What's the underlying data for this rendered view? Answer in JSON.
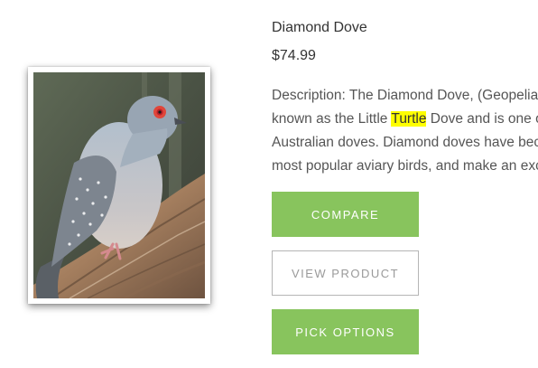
{
  "product": {
    "name": "Diamond Dove",
    "price": "$74.99",
    "description_lines": [
      {
        "before": "Description: The Diamond Dove, (Geopelia cuneata) is also",
        "highlight": "",
        "after": ""
      },
      {
        "before": "known as the Little ",
        "highlight": "Turtle",
        "after": " Dove and is one of the smallest"
      },
      {
        "before": "Australian doves.  Diamond doves have become one of the",
        "highlight": "",
        "after": ""
      },
      {
        "before": "most popular aviary birds, and make an excellent pet.",
        "highlight": "",
        "after": ""
      }
    ],
    "image_icon": "bird-photo"
  },
  "buttons": {
    "compare": "COMPARE",
    "view_product": "VIEW PRODUCT",
    "pick_options": "PICK OPTIONS"
  },
  "colors": {
    "accent_green": "#88c45d",
    "highlight_yellow": "#ffff00",
    "outline_border": "#b5b5b5"
  }
}
